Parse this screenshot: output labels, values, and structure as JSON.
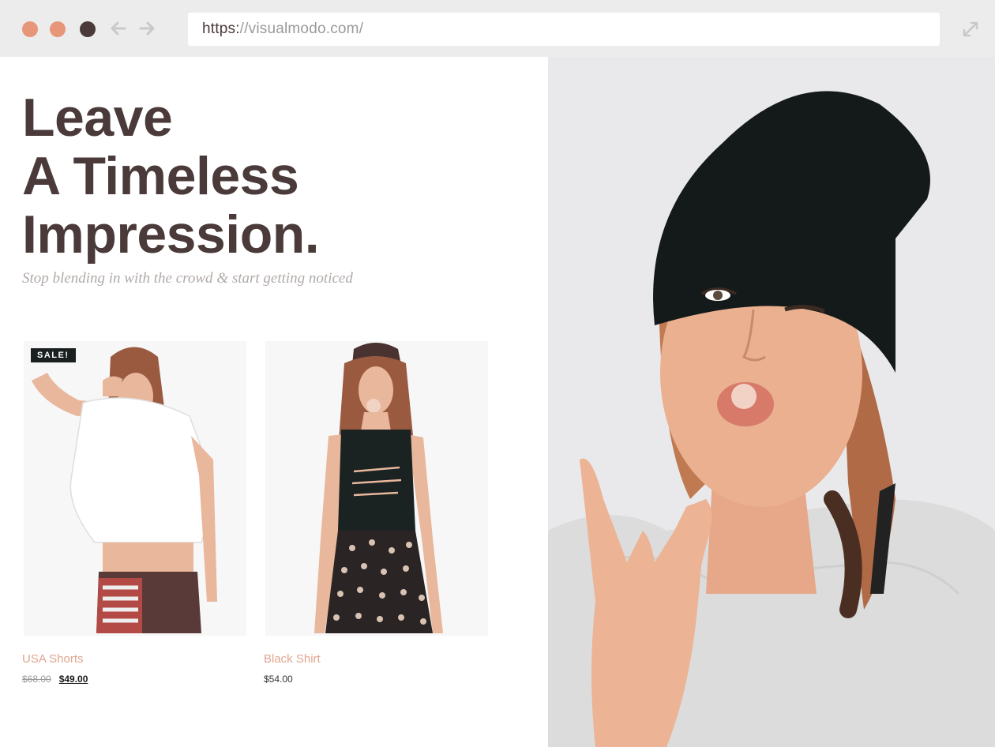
{
  "browser": {
    "url_scheme": "https:",
    "url_rest": "//visualmodo.com/",
    "window_controls": [
      "close-dot",
      "minimize-dot",
      "maximize-dot"
    ],
    "nav_icons": [
      "back-arrow-icon",
      "forward-arrow-icon"
    ],
    "expand_icon": "expand-icon"
  },
  "hero": {
    "title_lines": [
      "Leave",
      "A Timeless",
      "Impression."
    ],
    "tagline": "Stop blending in with the crowd & start getting noticed"
  },
  "products": [
    {
      "name": "USA Shorts",
      "badge": "SALE!",
      "old_price": "$68.00",
      "price": "$49.00"
    },
    {
      "name": "Black Shirt",
      "price": "$54.00"
    }
  ],
  "colors": {
    "dot_orange": "#e8967a",
    "dot_dark": "#4a3a3a",
    "title": "#4a3a3a",
    "product_name": "#e0a58f",
    "badge_bg": "#1a2020"
  }
}
